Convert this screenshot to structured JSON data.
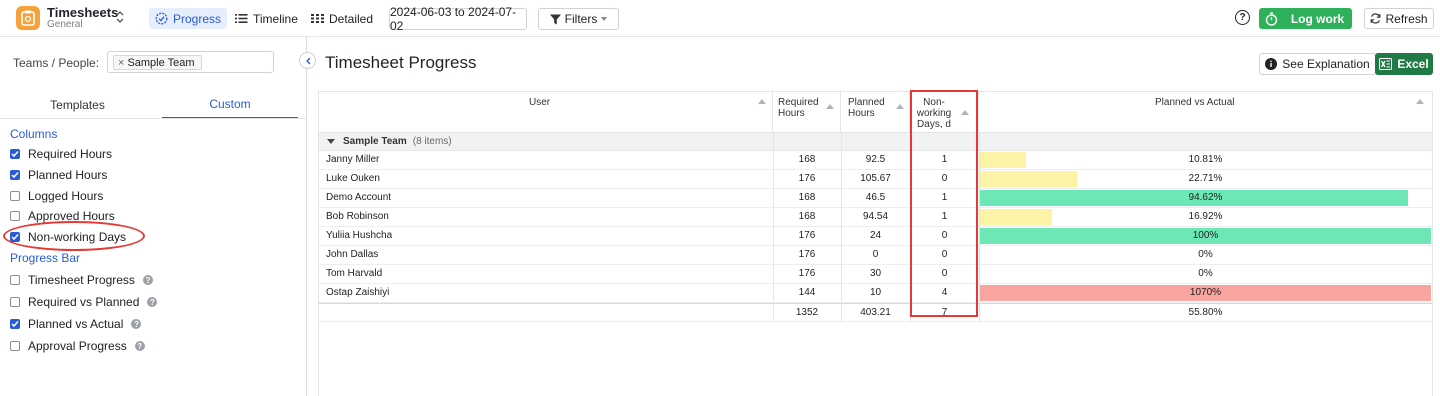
{
  "header": {
    "app_title": "Timesheets",
    "app_subtitle": "General",
    "views": [
      {
        "label": "Progress",
        "icon": "progress-gauge-icon",
        "active": true
      },
      {
        "label": "Timeline",
        "icon": "list-icon",
        "active": false
      },
      {
        "label": "Detailed",
        "icon": "grid-icon",
        "active": false
      }
    ],
    "date_range": "2024-06-03 to 2024-07-02",
    "filters_label": "Filters",
    "help_icon": "?",
    "log_work_label": "Log work",
    "refresh_label": "Refresh",
    "accent_color": "#2a5bd7",
    "green_color": "#2fb05a"
  },
  "sidebar": {
    "teams_label": "Teams / People:",
    "team_chip": "Sample Team",
    "chip_remove": "×",
    "tabs": [
      {
        "label": "Templates",
        "active": false
      },
      {
        "label": "Custom",
        "active": true
      }
    ],
    "columns_title": "Columns",
    "columns": [
      {
        "label": "Required Hours",
        "checked": true
      },
      {
        "label": "Planned Hours",
        "checked": true
      },
      {
        "label": "Logged Hours",
        "checked": false
      },
      {
        "label": "Approved Hours",
        "checked": false
      },
      {
        "label": "Non-working Days",
        "checked": true
      }
    ],
    "progress_title": "Progress Bar",
    "progress_bars": [
      {
        "label": "Timesheet Progress",
        "checked": false
      },
      {
        "label": "Required vs Planned",
        "checked": false
      },
      {
        "label": "Planned vs Actual",
        "checked": true
      },
      {
        "label": "Approval Progress",
        "checked": false
      }
    ]
  },
  "main": {
    "title": "Timesheet Progress",
    "explanation_label": "See Explanation",
    "excel_label": "Excel",
    "columns": {
      "user": "User",
      "required_1": "Required",
      "required_2": "Hours",
      "planned_1": "Planned",
      "planned_2": "Hours",
      "nonworking_1": "Non-",
      "nonworking_2": "working",
      "nonworking_3": "Days, d",
      "pva": "Planned vs Actual"
    },
    "group": {
      "name": "Sample Team",
      "count": "(8 items)"
    },
    "rows": [
      {
        "user": "Janny Miller",
        "required": "168",
        "planned": "92.5",
        "nonworking": "1",
        "pct_label": "10.81%",
        "fill": 0.1081,
        "color": "#fdf3a6"
      },
      {
        "user": "Luke Ouken",
        "required": "176",
        "planned": "105.67",
        "nonworking": "0",
        "pct_label": "22.71%",
        "fill": 0.2271,
        "color": "#fdf3a6"
      },
      {
        "user": "Demo Account",
        "required": "168",
        "planned": "46.5",
        "nonworking": "1",
        "pct_label": "94.62%",
        "fill": 0.9462,
        "color": "#6ee7b7"
      },
      {
        "user": "Bob Robinson",
        "required": "168",
        "planned": "94.54",
        "nonworking": "1",
        "pct_label": "16.92%",
        "fill": 0.1692,
        "color": "#fdf3a6"
      },
      {
        "user": "Yuliia Hushcha",
        "required": "176",
        "planned": "24",
        "nonworking": "0",
        "pct_label": "100%",
        "fill": 1.0,
        "color": "#6ee7b7"
      },
      {
        "user": "John Dallas",
        "required": "176",
        "planned": "0",
        "nonworking": "0",
        "pct_label": "0%",
        "fill": 0,
        "color": "#fdf3a6"
      },
      {
        "user": "Tom Harvald",
        "required": "176",
        "planned": "30",
        "nonworking": "0",
        "pct_label": "0%",
        "fill": 0,
        "color": "#fdf3a6"
      },
      {
        "user": "Ostap Zaishiyi",
        "required": "144",
        "planned": "10",
        "nonworking": "4",
        "pct_label": "1070%",
        "fill": 1.0,
        "color": "#f8a5a0"
      }
    ],
    "totals": {
      "required": "1352",
      "planned": "403.21",
      "nonworking": "7",
      "pct_label": "55.80%"
    }
  }
}
